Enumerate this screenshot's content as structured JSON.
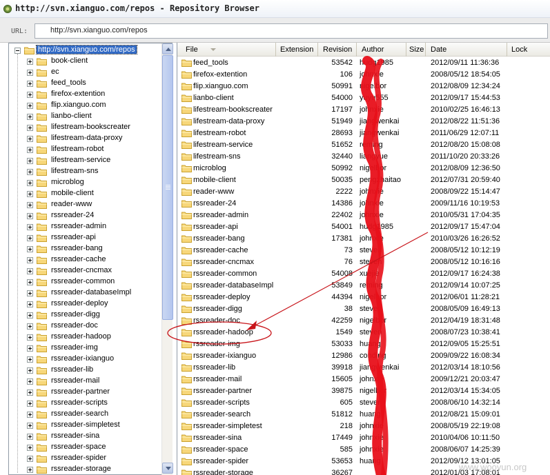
{
  "window": {
    "title": "http://svn.xianguo.com/repos - Repository Browser"
  },
  "urlbar": {
    "label": "URL:",
    "value": "http://svn.xianguo.com/repos"
  },
  "tree": {
    "root": "http://svn.xianguo.com/repos",
    "items": [
      "book-client",
      "ec",
      "feed_tools",
      "firefox-extention",
      "flip.xianguo.com",
      "lianbo-client",
      "lifestream-bookscreater",
      "lifestream-data-proxy",
      "lifestream-robot",
      "lifestream-service",
      "lifestream-sns",
      "microblog",
      "mobile-client",
      "reader-www",
      "rssreader-24",
      "rssreader-admin",
      "rssreader-api",
      "rssreader-bang",
      "rssreader-cache",
      "rssreader-cncmax",
      "rssreader-common",
      "rssreader-databaseImpl",
      "rssreader-deploy",
      "rssreader-digg",
      "rssreader-doc",
      "rssreader-hadoop",
      "rssreader-img",
      "rssreader-ixianguo",
      "rssreader-lib",
      "rssreader-mail",
      "rssreader-partner",
      "rssreader-scripts",
      "rssreader-search",
      "rssreader-simpletest",
      "rssreader-sina",
      "rssreader-space",
      "rssreader-spider",
      "rssreader-storage"
    ]
  },
  "list": {
    "columns": [
      "File",
      "Extension",
      "Revision",
      "Author",
      "Size",
      "Date",
      "Lock"
    ],
    "rows": [
      {
        "name": "feed_tools",
        "rev": "53542",
        "author": "hudg1985",
        "date": "2012/09/11 11:36:36"
      },
      {
        "name": "firefox-extention",
        "rev": "106",
        "author": "johnxie",
        "date": "2008/05/12 18:54:05"
      },
      {
        "name": "flip.xianguo.com",
        "rev": "50991",
        "author": "nigelbor",
        "date": "2012/08/09 12:34:24"
      },
      {
        "name": "lianbo-client",
        "rev": "54000",
        "author": "yuyu555",
        "date": "2012/09/17 15:44:53"
      },
      {
        "name": "lifestream-bookscreater",
        "rev": "17197",
        "author": "johnxie",
        "date": "2010/02/25 16:46:13"
      },
      {
        "name": "lifestream-data-proxy",
        "rev": "51949",
        "author": "jiangwenkai",
        "date": "2012/08/22 11:51:36"
      },
      {
        "name": "lifestream-robot",
        "rev": "28693",
        "author": "jiangwenkai",
        "date": "2011/06/29 12:07:11"
      },
      {
        "name": "lifestream-service",
        "rev": "51652",
        "author": "reming",
        "date": "2012/08/20 15:08:08"
      },
      {
        "name": "lifestream-sns",
        "rev": "32440",
        "author": "liangyue",
        "date": "2011/10/20 20:33:26"
      },
      {
        "name": "microblog",
        "rev": "50992",
        "author": "nigelbor",
        "date": "2012/08/09 12:36:50"
      },
      {
        "name": "mobile-client",
        "rev": "50035",
        "author": "pengzhaitao",
        "date": "2012/07/31 20:59:40"
      },
      {
        "name": "reader-www",
        "rev": "2222",
        "author": "johnxie",
        "date": "2008/09/22 15:14:47"
      },
      {
        "name": "rssreader-24",
        "rev": "14386",
        "author": "johnxie",
        "date": "2009/11/16 10:19:53"
      },
      {
        "name": "rssreader-admin",
        "rev": "22402",
        "author": "johnxie",
        "date": "2010/05/31 17:04:35"
      },
      {
        "name": "rssreader-api",
        "rev": "54001",
        "author": "hudg1985",
        "date": "2012/09/17 15:47:04"
      },
      {
        "name": "rssreader-bang",
        "rev": "17381",
        "author": "johnxie",
        "date": "2010/03/26 16:26:52"
      },
      {
        "name": "rssreader-cache",
        "rev": "73",
        "author": "steven",
        "date": "2008/05/12 10:12:19"
      },
      {
        "name": "rssreader-cncmax",
        "rev": "76",
        "author": "steven",
        "date": "2008/05/12 10:16:16"
      },
      {
        "name": "rssreader-common",
        "rev": "54008",
        "author": "xuejie",
        "date": "2012/09/17 16:24:38"
      },
      {
        "name": "rssreader-databaseImpl",
        "rev": "53849",
        "author": "reming",
        "date": "2012/09/14 10:07:25"
      },
      {
        "name": "rssreader-deploy",
        "rev": "44394",
        "author": "nigelbor",
        "date": "2012/06/01 11:28:21"
      },
      {
        "name": "rssreader-digg",
        "rev": "38",
        "author": "steven",
        "date": "2008/05/09 16:49:13"
      },
      {
        "name": "rssreader-doc",
        "rev": "42259",
        "author": "nigelbor",
        "date": "2012/04/19 18:31:48"
      },
      {
        "name": "rssreader-hadoop",
        "rev": "1549",
        "author": "steven",
        "date": "2008/07/23 10:38:41"
      },
      {
        "name": "rssreader-img",
        "rev": "53033",
        "author": "huang",
        "date": "2012/09/05 15:25:51"
      },
      {
        "name": "rssreader-ixianguo",
        "rev": "12986",
        "author": "conding",
        "date": "2009/09/22 16:08:34"
      },
      {
        "name": "rssreader-lib",
        "rev": "39918",
        "author": "jiangwenkai",
        "date": "2012/03/14 18:10:56"
      },
      {
        "name": "rssreader-mail",
        "rev": "15605",
        "author": "johnxie",
        "date": "2009/12/21 20:03:47"
      },
      {
        "name": "rssreader-partner",
        "rev": "39875",
        "author": "nigelbor",
        "date": "2012/03/14 15:34:05"
      },
      {
        "name": "rssreader-scripts",
        "rev": "605",
        "author": "steven",
        "date": "2008/06/10 14:32:14"
      },
      {
        "name": "rssreader-search",
        "rev": "51812",
        "author": "huang",
        "date": "2012/08/21 15:09:01"
      },
      {
        "name": "rssreader-simpletest",
        "rev": "218",
        "author": "johnxie",
        "date": "2008/05/19 22:19:08"
      },
      {
        "name": "rssreader-sina",
        "rev": "17449",
        "author": "johnxie",
        "date": "2010/04/06 10:11:50"
      },
      {
        "name": "rssreader-space",
        "rev": "585",
        "author": "johnxie",
        "date": "2008/06/07 14:25:39"
      },
      {
        "name": "rssreader-spider",
        "rev": "53653",
        "author": "huang",
        "date": "2012/09/12 13:01:05"
      },
      {
        "name": "rssreader-storage",
        "rev": "36267",
        "author": "",
        "date": "2012/01/03 17:08:01"
      }
    ]
  },
  "watermark": "www.wooyun.org",
  "colors": {
    "selection": "#316ac5",
    "folder": "#f7d77a",
    "annotation": "#e8101a"
  }
}
